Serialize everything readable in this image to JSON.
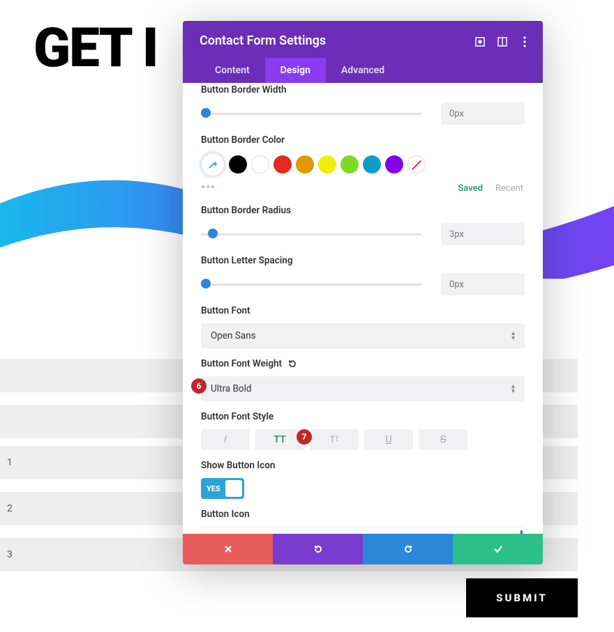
{
  "bg": {
    "title": "GET I",
    "rows": {
      "r3": "1",
      "r4": "2",
      "r5": "3"
    },
    "submit": "SUBMIT"
  },
  "panel": {
    "title": "Contact Form Settings",
    "tabs": {
      "content": "Content",
      "design": "Design",
      "advanced": "Advanced"
    }
  },
  "fields": {
    "border_width": {
      "label": "Button Border Width",
      "value": "0px"
    },
    "border_color": {
      "label": "Button Border Color"
    },
    "swatch_tabs": {
      "saved": "Saved",
      "recent": "Recent"
    },
    "border_radius": {
      "label": "Button Border Radius",
      "value": "3px"
    },
    "letter_spacing": {
      "label": "Button Letter Spacing",
      "value": "0px"
    },
    "font": {
      "label": "Button Font",
      "value": "Open Sans"
    },
    "font_weight": {
      "label": "Button Font Weight",
      "value": "Ultra Bold"
    },
    "font_style": {
      "label": "Button Font Style"
    },
    "show_icon": {
      "label": "Show Button Icon",
      "toggle": "YES"
    },
    "icon": {
      "label": "Button Icon"
    }
  },
  "callouts": {
    "six": "6",
    "seven": "7"
  },
  "colors": {
    "black": "#000000",
    "white": "#ffffff",
    "red": "#e02b20",
    "orange": "#e09900",
    "yellow": "#edf000",
    "green": "#7cda24",
    "teal": "#0c9ec7",
    "purple": "#8300e9"
  },
  "icons": [
    "↑",
    "↓",
    "←",
    "→",
    "↖",
    "↗",
    "↘",
    "↙",
    "↕",
    "⇥",
    "⇤",
    "↔",
    "↖",
    "↗",
    "⤡",
    "⤢",
    "✥",
    "˄",
    "˅",
    "‹",
    "›",
    "︽",
    "︾",
    "«",
    "»",
    "⊙",
    "⊘",
    "⊖",
    "⊕",
    "⊗",
    "⊜",
    "«",
    "»",
    "▴",
    "▾",
    "◂",
    "▸",
    "⊛",
    "⊚",
    "◉",
    "◎",
    "↶"
  ]
}
